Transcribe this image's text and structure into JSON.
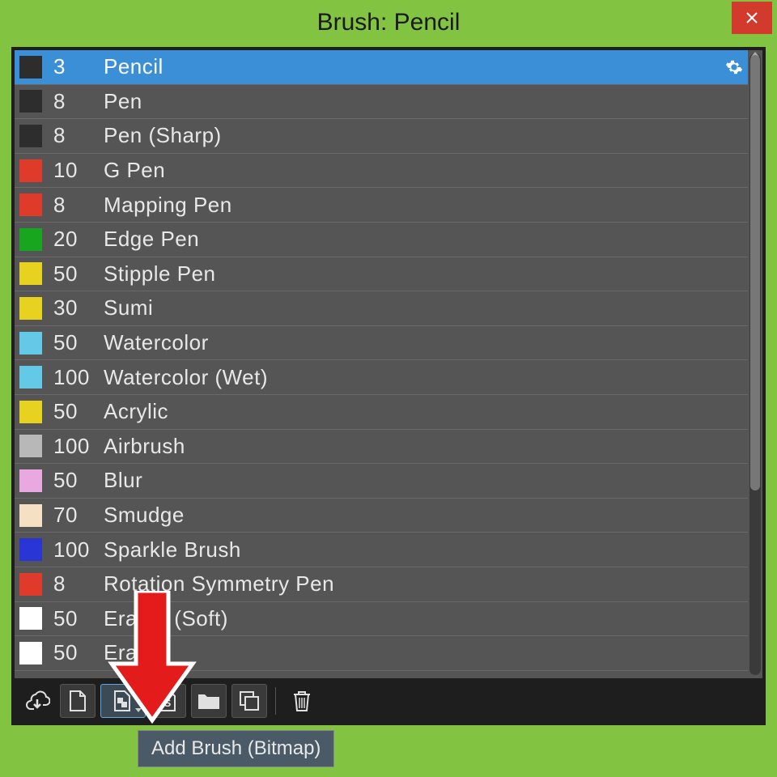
{
  "window": {
    "title": "Brush: Pencil"
  },
  "tooltip": {
    "text": "Add Brush (Bitmap)"
  },
  "toolbar": {
    "icons": {
      "cloud_download": "cloud-download-icon",
      "new_doc": "new-document-icon",
      "add_bitmap": "add-brush-bitmap-icon",
      "add_script": "add-brush-script-icon",
      "folder": "folder-icon",
      "duplicate": "duplicate-icon",
      "delete": "trash-icon"
    }
  },
  "brushes": [
    {
      "size": "3",
      "name": "Pencil",
      "color": "#2d2d2d",
      "selected": true
    },
    {
      "size": "8",
      "name": "Pen",
      "color": "#2d2d2d",
      "selected": false
    },
    {
      "size": "8",
      "name": "Pen (Sharp)",
      "color": "#2d2d2d",
      "selected": false
    },
    {
      "size": "10",
      "name": "G Pen",
      "color": "#e03a2a",
      "selected": false
    },
    {
      "size": "8",
      "name": "Mapping Pen",
      "color": "#e03a2a",
      "selected": false
    },
    {
      "size": "20",
      "name": "Edge Pen",
      "color": "#18a61f",
      "selected": false
    },
    {
      "size": "50",
      "name": "Stipple Pen",
      "color": "#e6d21f",
      "selected": false
    },
    {
      "size": "30",
      "name": "Sumi",
      "color": "#e6d21f",
      "selected": false
    },
    {
      "size": "50",
      "name": "Watercolor",
      "color": "#63c9e6",
      "selected": false
    },
    {
      "size": "100",
      "name": "Watercolor (Wet)",
      "color": "#63c9e6",
      "selected": false
    },
    {
      "size": "50",
      "name": "Acrylic",
      "color": "#e6d21f",
      "selected": false
    },
    {
      "size": "100",
      "name": "Airbrush",
      "color": "#b8b8b8",
      "selected": false
    },
    {
      "size": "50",
      "name": "Blur",
      "color": "#e9a8e0",
      "selected": false
    },
    {
      "size": "70",
      "name": "Smudge",
      "color": "#f6e0c4",
      "selected": false
    },
    {
      "size": "100",
      "name": "Sparkle Brush",
      "color": "#2a35d6",
      "selected": false
    },
    {
      "size": "8",
      "name": "Rotation Symmetry Pen",
      "color": "#e03a2a",
      "selected": false
    },
    {
      "size": "50",
      "name": "Eraser (Soft)",
      "color": "#ffffff",
      "selected": false
    },
    {
      "size": "50",
      "name": "Eraser",
      "color": "#ffffff",
      "selected": false
    }
  ]
}
